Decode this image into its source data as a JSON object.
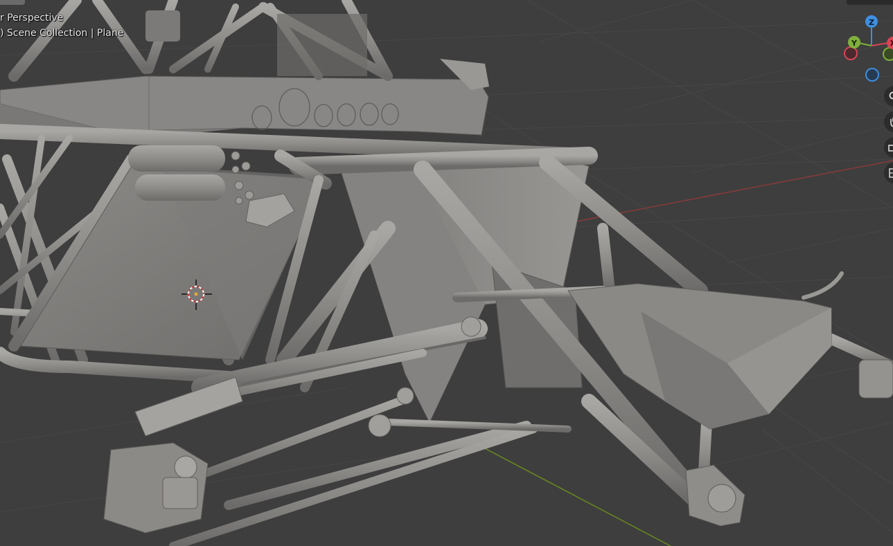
{
  "viewport": {
    "view_name": "r Perspective",
    "collection_line": ") Scene Collection | Plane"
  },
  "navigation_gizmo": {
    "z_label": "Z",
    "y_label": "Y",
    "x_label": "X",
    "colors": {
      "x_axis": "#d94455",
      "y_axis": "#7fb13a",
      "z_axis": "#3f8fe0"
    }
  },
  "side_toolbar": {
    "zoom_icon": "magnifier-icon",
    "pan_icon": "hand-icon",
    "camera_icon": "camera-icon",
    "ortho_icon": "grid-icon"
  },
  "colors": {
    "background": "#3e3e3e",
    "grid_line": "#464646",
    "x_axis_line": "#8a3a3a",
    "y_axis_line": "#6a8a1e",
    "model_base": "#8e8c8a",
    "model_shadow": "#6b6a68",
    "model_highlight": "#aaa8a5"
  }
}
